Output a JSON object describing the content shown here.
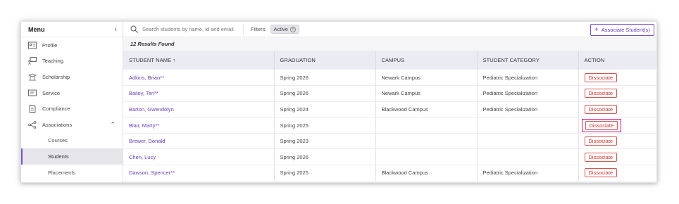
{
  "sidebar": {
    "title": "Menu",
    "items": [
      {
        "label": "Profile",
        "icon": "profile-card-icon"
      },
      {
        "label": "Teaching",
        "icon": "teaching-icon"
      },
      {
        "label": "Scholarship",
        "icon": "scholarship-icon"
      },
      {
        "label": "Service",
        "icon": "service-icon"
      },
      {
        "label": "Compliance",
        "icon": "compliance-icon"
      },
      {
        "label": "Associations",
        "icon": "associations-icon"
      }
    ],
    "sub_items": [
      {
        "label": "Courses"
      },
      {
        "label": "Students",
        "active": true
      },
      {
        "label": "Placements"
      }
    ]
  },
  "search": {
    "placeholder": "Search students by name, id and email"
  },
  "filters": {
    "label": "Filters:",
    "chips": [
      {
        "label": "Active"
      }
    ]
  },
  "associate_button": {
    "label": "Associate Student(s)"
  },
  "results_text": "12 Results Found",
  "table": {
    "columns": [
      "STUDENT NAME",
      "GRADUATION",
      "CAMPUS",
      "STUDENT CATEGORY",
      "ACTION"
    ],
    "sort_indicator": "↑",
    "action_label": "Dissociate",
    "rows": [
      {
        "name": "Adkins, Brian**",
        "graduation": "Spring 2026",
        "campus": "Newark Campus",
        "category": "Pediatric Specialization"
      },
      {
        "name": "Bailey, Teri**",
        "graduation": "Spring 2026",
        "campus": "Newark Campus",
        "category": "Pediatric Specialization"
      },
      {
        "name": "Barton, Gwendolyn",
        "graduation": "Spring 2024",
        "campus": "Blackwood Campus",
        "category": "Pediatric Specialization"
      },
      {
        "name": "Blair, Marty**",
        "graduation": "Spring 2025",
        "campus": "",
        "category": ""
      },
      {
        "name": "Brewer, Donald",
        "graduation": "Spring 2023",
        "campus": "",
        "category": ""
      },
      {
        "name": "Chen, Lucy",
        "graduation": "Spring 2026",
        "campus": "",
        "category": ""
      },
      {
        "name": "Dawson, Spencer**",
        "graduation": "Spring 2025",
        "campus": "Blackwood Campus",
        "category": "Pediatric Specialization"
      }
    ]
  },
  "colors": {
    "accent": "#6a3fb8",
    "danger": "#c9302c",
    "highlight": "#c21a8a"
  }
}
